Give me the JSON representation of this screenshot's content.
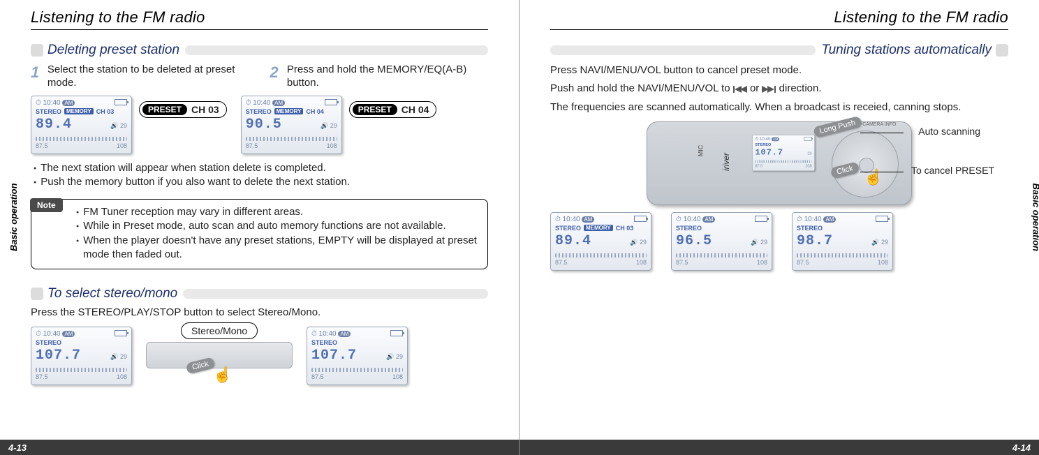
{
  "left": {
    "title": "Listening to the FM radio",
    "side_label": "Basic operation",
    "page_no": "4-13",
    "sec1": {
      "heading": "Deleting preset station",
      "step1_text": "Select the station to be deleted at preset mode.",
      "step2_text": "Press and hold the MEMORY/EQ(A-B) button.",
      "badge1_preset": "PRESET",
      "badge1_ch": "CH 03",
      "badge2_preset": "PRESET",
      "badge2_ch": "CH 04",
      "bullets": [
        "The next station will appear when station delete is completed.",
        "Push the memory button if you also want to delete the next station."
      ],
      "note_label": "Note",
      "note_items": [
        "FM Tuner reception may vary in different areas.",
        "While in Preset mode, auto scan and auto memory functions are not available.",
        "When the player doesn't have any preset stations, EMPTY will be displayed at preset mode then faded out."
      ],
      "lcd1": {
        "clock": "10:40",
        "ampm": "AM",
        "stereo": "STEREO",
        "memory": "MEMORY",
        "ch": "CH 03",
        "freq": "89.4",
        "vol": "29",
        "lo": "87.5",
        "hi": "108"
      },
      "lcd2": {
        "clock": "10:40",
        "ampm": "AM",
        "stereo": "STEREO",
        "memory": "MEMORY",
        "ch": "CH 04",
        "freq": "90.5",
        "vol": "29",
        "lo": "87.5",
        "hi": "108"
      }
    },
    "sec2": {
      "heading": "To select stereo/mono",
      "desc": "Press the STEREO/PLAY/STOP button to select Stereo/Mono.",
      "mid_label": "Stereo/Mono",
      "click_label": "Click",
      "lcdA": {
        "clock": "10:40",
        "ampm": "AM",
        "stereo": "STEREO",
        "freq": "107.7",
        "vol": "29",
        "lo": "87.5",
        "hi": "108"
      },
      "lcdB": {
        "clock": "10:40",
        "ampm": "AM",
        "stereo": "STEREO",
        "freq": "107.7",
        "vol": "29",
        "lo": "87.5",
        "hi": "108"
      }
    }
  },
  "right": {
    "title": "Listening to the FM radio",
    "side_label": "Basic operation",
    "page_no": "4-14",
    "sec": {
      "heading": "Tuning stations automatically",
      "lines": [
        "Press NAVI/MENU/VOL button to cancel preset mode.",
        "Push and hold the NAVI/MENU/VOL to {prev} or {next} direction.",
        "The frequencies are scanned automatically. When a broadcast is receied, canning stops."
      ],
      "callout_long": "Long Push",
      "callout_click": "Click",
      "label_auto": "Auto scanning",
      "label_cancel": "To cancel PRESET",
      "device": {
        "brand": "iriver",
        "mic": "MIC",
        "wheel_text": "NAVI/MENU-CAMERA INFO"
      },
      "lcd_dev": {
        "clock": "10:40",
        "ampm": "AM",
        "stereo": "STEREO",
        "freq": "107.7",
        "vol": "29",
        "lo": "87.5",
        "hi": "108"
      },
      "lcd1": {
        "clock": "10:40",
        "ampm": "AM",
        "stereo": "STEREO",
        "memory": "MEMORY",
        "ch": "CH 03",
        "freq": "89.4",
        "vol": "29",
        "lo": "87.5",
        "hi": "108"
      },
      "lcd2": {
        "clock": "10:40",
        "ampm": "AM",
        "stereo": "STEREO",
        "freq": "96.5",
        "vol": "29",
        "lo": "87.5",
        "hi": "108"
      },
      "lcd3": {
        "clock": "10:40",
        "ampm": "AM",
        "stereo": "STEREO",
        "freq": "98.7",
        "vol": "29",
        "lo": "87.5",
        "hi": "108"
      }
    }
  }
}
